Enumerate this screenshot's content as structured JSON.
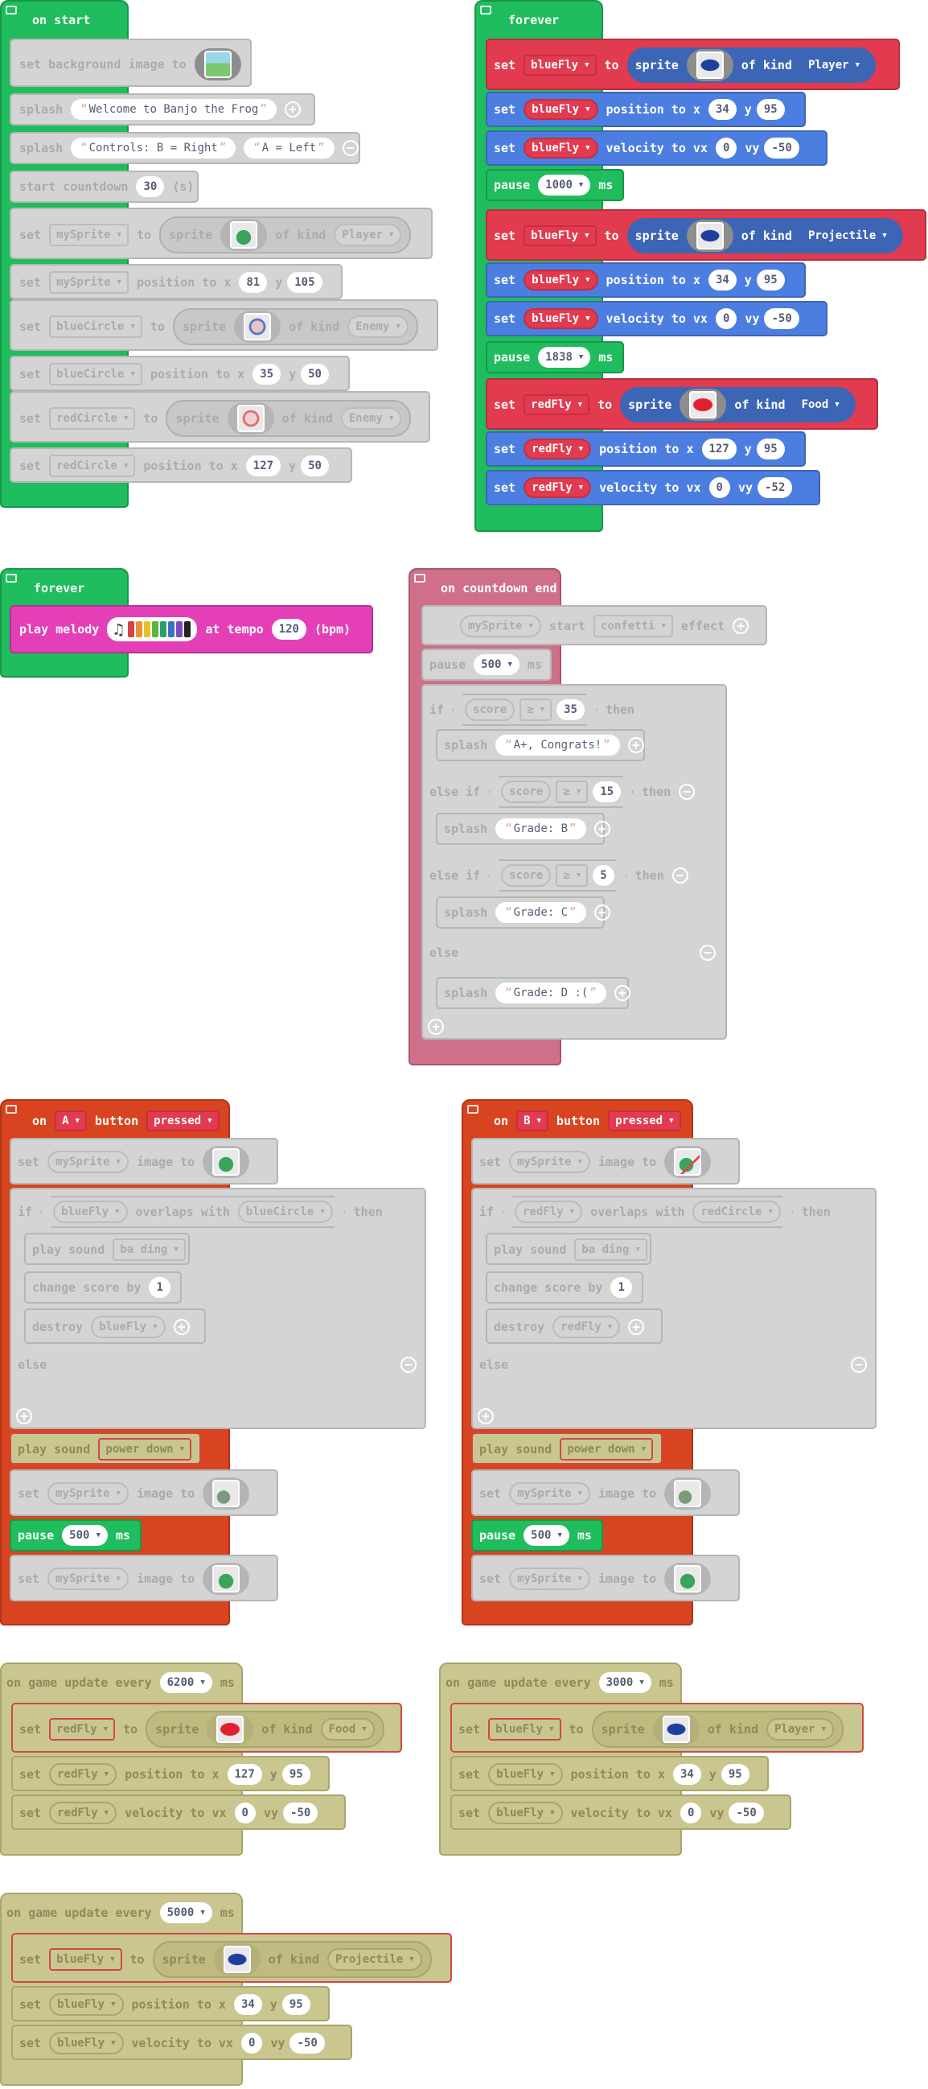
{
  "colors": {
    "event_green": "#1fbd5d",
    "event_magenta": "#e53fb8",
    "event_pink": "#d06f8a",
    "event_red": "#d8441f",
    "event_olive": "#cac690",
    "sprites_red": "#e23a4e",
    "sprites_blue": "#4c7ee2",
    "loops_green": "#1fbd5d",
    "disabled_grey": "#d4d4d4"
  },
  "on_start": {
    "header": "on start",
    "bg": {
      "set": "set background image to",
      "icon": "background-image-icon"
    },
    "splash1": {
      "kw": "splash",
      "text": "Welcome to Banjo the Frog"
    },
    "splash2": {
      "kw": "splash",
      "text1": "Controls: B = Right",
      "text2": "A = Left"
    },
    "countdown": {
      "kw": "start countdown",
      "value": "30",
      "unit": "(s)"
    },
    "s1": {
      "set": "set",
      "var": "mySprite",
      "to": "to",
      "sprite": "sprite",
      "of_kind": "of kind",
      "kind": "Player",
      "icon": "frog-sprite-icon"
    },
    "p1": {
      "set": "set",
      "var": "mySprite",
      "label": "position to x",
      "x": "81",
      "y_label": "y",
      "y": "105"
    },
    "s2": {
      "set": "set",
      "var": "blueCircle",
      "to": "to",
      "sprite": "sprite",
      "of_kind": "of kind",
      "kind": "Enemy",
      "icon": "blue-circle-sprite-icon"
    },
    "p2": {
      "set": "set",
      "var": "blueCircle",
      "label": "position to x",
      "x": "35",
      "y_label": "y",
      "y": "50"
    },
    "s3": {
      "set": "set",
      "var": "redCircle",
      "to": "to",
      "sprite": "sprite",
      "of_kind": "of kind",
      "kind": "Enemy",
      "icon": "red-circle-sprite-icon"
    },
    "p3": {
      "set": "set",
      "var": "redCircle",
      "label": "position to x",
      "x": "127",
      "y_label": "y",
      "y": "50"
    }
  },
  "forever1": {
    "header": "forever",
    "s1": {
      "set": "set",
      "var": "blueFly",
      "to": "to",
      "sprite": "sprite",
      "of_kind": "of kind",
      "kind": "Player",
      "icon": "blue-fly-sprite-icon"
    },
    "p1": {
      "set": "set",
      "var": "blueFly",
      "label": "position to x",
      "x": "34",
      "y_label": "y",
      "y": "95"
    },
    "v1": {
      "set": "set",
      "var": "blueFly",
      "label": "velocity to vx",
      "vx": "0",
      "vy_label": "vy",
      "vy": "-50"
    },
    "pause1": {
      "kw": "pause",
      "value": "1000",
      "unit": "ms"
    },
    "s2": {
      "set": "set",
      "var": "blueFly",
      "to": "to",
      "sprite": "sprite",
      "of_kind": "of kind",
      "kind": "Projectile",
      "icon": "blue-fly-sprite-icon"
    },
    "p2": {
      "set": "set",
      "var": "blueFly",
      "label": "position to x",
      "x": "34",
      "y_label": "y",
      "y": "95"
    },
    "v2": {
      "set": "set",
      "var": "blueFly",
      "label": "velocity to vx",
      "vx": "0",
      "vy_label": "vy",
      "vy": "-50"
    },
    "pause2": {
      "kw": "pause",
      "value": "1838",
      "unit": "ms"
    },
    "s3": {
      "set": "set",
      "var": "redFly",
      "to": "to",
      "sprite": "sprite",
      "of_kind": "of kind",
      "kind": "Food",
      "icon": "red-fly-sprite-icon"
    },
    "p3": {
      "set": "set",
      "var": "redFly",
      "label": "position to x",
      "x": "127",
      "y_label": "y",
      "y": "95"
    },
    "v3": {
      "set": "set",
      "var": "redFly",
      "label": "velocity to vx",
      "vx": "0",
      "vy_label": "vy",
      "vy": "-52"
    }
  },
  "forever2": {
    "header": "forever",
    "play": "play melody",
    "at_tempo": "at tempo",
    "tempo": "120",
    "unit": "(bpm)",
    "icon": "music-note-icon"
  },
  "countdown_end": {
    "header": "on countdown end",
    "effect": {
      "var": "mySprite",
      "start": "start",
      "effect": "confetti",
      "label": "effect"
    },
    "pause": {
      "kw": "pause",
      "value": "500",
      "unit": "ms"
    },
    "if1": {
      "kw": "if",
      "var": "score",
      "op": "≥",
      "value": "35",
      "then": "then"
    },
    "sp1": {
      "kw": "splash",
      "text": "A+, Congrats!"
    },
    "if2": {
      "kw": "else if",
      "var": "score",
      "op": "≥",
      "value": "15",
      "then": "then"
    },
    "sp2": {
      "kw": "splash",
      "text": "Grade: B"
    },
    "if3": {
      "kw": "else if",
      "var": "score",
      "op": "≥",
      "value": "5",
      "then": "then"
    },
    "sp3": {
      "kw": "splash",
      "text": "Grade: C"
    },
    "else": "else",
    "sp4": {
      "kw": "splash",
      "text": "Grade: D :("
    }
  },
  "btnA": {
    "on": "on",
    "button": "A",
    "label": "button",
    "event": "pressed",
    "img1": {
      "set": "set",
      "var": "mySprite",
      "label": "image to",
      "icon": "frog-sprite-icon"
    },
    "if": {
      "kw": "if",
      "var1": "blueFly",
      "mid": "overlaps with",
      "var2": "blueCircle",
      "then": "then"
    },
    "snd": {
      "kw": "play sound",
      "sound": "ba ding"
    },
    "score": {
      "kw": "change score by",
      "value": "1"
    },
    "destroy": {
      "kw": "destroy",
      "var": "blueFly"
    },
    "else": "else",
    "snd2": {
      "kw": "play sound",
      "sound": "power down"
    },
    "img2": {
      "set": "set",
      "var": "mySprite",
      "label": "image to",
      "icon": "frog-hurt-sprite-icon"
    },
    "pause": {
      "kw": "pause",
      "value": "500",
      "unit": "ms"
    },
    "img3": {
      "set": "set",
      "var": "mySprite",
      "label": "image to",
      "icon": "frog-sprite-icon"
    }
  },
  "btnB": {
    "on": "on",
    "button": "B",
    "label": "button",
    "event": "pressed",
    "img1": {
      "set": "set",
      "var": "mySprite",
      "label": "image to",
      "icon": "frog-tongue-sprite-icon"
    },
    "if": {
      "kw": "if",
      "var1": "redFly",
      "mid": "overlaps with",
      "var2": "redCircle",
      "then": "then"
    },
    "snd": {
      "kw": "play sound",
      "sound": "ba ding"
    },
    "score": {
      "kw": "change score by",
      "value": "1"
    },
    "destroy": {
      "kw": "destroy",
      "var": "redFly"
    },
    "else": "else",
    "snd2": {
      "kw": "play sound",
      "sound": "power down"
    },
    "img2": {
      "set": "set",
      "var": "mySprite",
      "label": "image to",
      "icon": "frog-hurt-sprite-icon"
    },
    "pause": {
      "kw": "pause",
      "value": "500",
      "unit": "ms"
    },
    "img3": {
      "set": "set",
      "var": "mySprite",
      "label": "image to",
      "icon": "frog-sprite-icon"
    }
  },
  "gu6200": {
    "header": "on game update every",
    "interval": "6200",
    "unit": "ms",
    "s": {
      "set": "set",
      "var": "redFly",
      "to": "to",
      "sprite": "sprite",
      "of_kind": "of kind",
      "kind": "Food"
    },
    "p": {
      "set": "set",
      "var": "redFly",
      "label": "position to x",
      "x": "127",
      "y_label": "y",
      "y": "95"
    },
    "v": {
      "set": "set",
      "var": "redFly",
      "label": "velocity to vx",
      "vx": "0",
      "vy_label": "vy",
      "vy": "-50"
    }
  },
  "gu3000": {
    "header": "on game update every",
    "interval": "3000",
    "unit": "ms",
    "s": {
      "set": "set",
      "var": "blueFly",
      "to": "to",
      "sprite": "sprite",
      "of_kind": "of kind",
      "kind": "Player"
    },
    "p": {
      "set": "set",
      "var": "blueFly",
      "label": "position to x",
      "x": "34",
      "y_label": "y",
      "y": "95"
    },
    "v": {
      "set": "set",
      "var": "blueFly",
      "label": "velocity to vx",
      "vx": "0",
      "vy_label": "vy",
      "vy": "-50"
    }
  },
  "gu5000": {
    "header": "on game update every",
    "interval": "5000",
    "unit": "ms",
    "s": {
      "set": "set",
      "var": "blueFly",
      "to": "to",
      "sprite": "sprite",
      "of_kind": "of kind",
      "kind": "Projectile"
    },
    "p": {
      "set": "set",
      "var": "blueFly",
      "label": "position to x",
      "x": "34",
      "y_label": "y",
      "y": "95"
    },
    "v": {
      "set": "set",
      "var": "blueFly",
      "label": "velocity to vx",
      "vx": "0",
      "vy_label": "vy",
      "vy": "-50"
    }
  }
}
